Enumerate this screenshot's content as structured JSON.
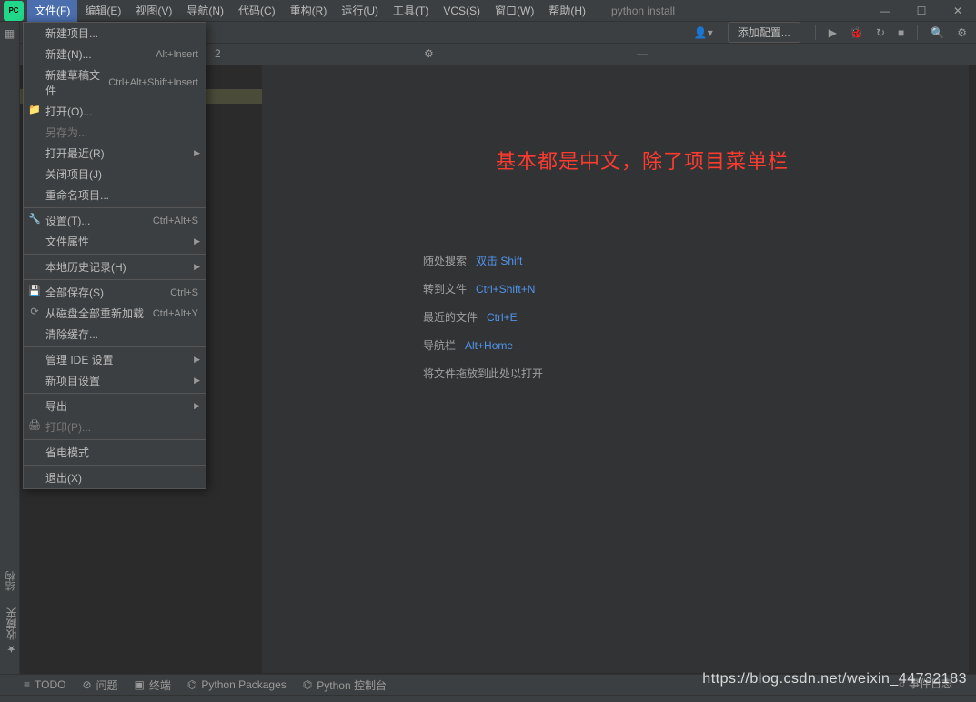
{
  "menubar": {
    "items": [
      {
        "label": "文件(F)",
        "active": true
      },
      {
        "label": "编辑(E)"
      },
      {
        "label": "视图(V)"
      },
      {
        "label": "导航(N)"
      },
      {
        "label": "代码(C)"
      },
      {
        "label": "重构(R)"
      },
      {
        "label": "运行(U)"
      },
      {
        "label": "工具(T)"
      },
      {
        "label": "VCS(S)"
      },
      {
        "label": "窗口(W)"
      },
      {
        "label": "帮助(H)"
      }
    ],
    "title": "python install"
  },
  "toolbar": {
    "config_label": "添加配置...",
    "user_icon": "user-icon"
  },
  "dropdown": [
    {
      "label": "新建项目..."
    },
    {
      "label": "新建(N)...",
      "shortcut": "Alt+Insert"
    },
    {
      "label": "新建草稿文件",
      "shortcut": "Ctrl+Alt+Shift+Insert"
    },
    {
      "label": "打开(O)...",
      "icon": "folder-icon"
    },
    {
      "label": "另存为...",
      "disabled": true
    },
    {
      "label": "打开最近(R)",
      "submenu": true
    },
    {
      "label": "关闭项目(J)"
    },
    {
      "label": "重命名项目..."
    },
    {
      "sep": true
    },
    {
      "label": "设置(T)...",
      "shortcut": "Ctrl+Alt+S",
      "icon": "wrench-icon"
    },
    {
      "label": "文件属性",
      "submenu": true
    },
    {
      "sep": true
    },
    {
      "label": "本地历史记录(H)",
      "submenu": true
    },
    {
      "sep": true
    },
    {
      "label": "全部保存(S)",
      "shortcut": "Ctrl+S",
      "icon": "save-icon"
    },
    {
      "label": "从磁盘全部重新加载",
      "shortcut": "Ctrl+Alt+Y",
      "icon": "reload-icon"
    },
    {
      "label": "清除缓存..."
    },
    {
      "sep": true
    },
    {
      "label": "管理 IDE 设置",
      "submenu": true
    },
    {
      "label": "新项目设置",
      "submenu": true
    },
    {
      "sep": true
    },
    {
      "label": "导出",
      "submenu": true
    },
    {
      "label": "打印(P)...",
      "disabled": true,
      "icon": "print-icon"
    },
    {
      "sep": true
    },
    {
      "label": "省电模式"
    },
    {
      "sep": true
    },
    {
      "label": "退出(X)"
    }
  ],
  "annotation": "基本都是中文，除了项目菜单栏",
  "welcome": {
    "rows": [
      {
        "label": "随处搜索",
        "link": "双击 Shift"
      },
      {
        "label": "转到文件",
        "link": "Ctrl+Shift+N"
      },
      {
        "label": "最近的文件",
        "link": "Ctrl+E"
      },
      {
        "label": "导航栏",
        "link": "Alt+Home"
      }
    ],
    "drop_hint": "将文件拖放到此处以打开"
  },
  "left_vertical": {
    "structure": "结构",
    "favorites": "收藏夹"
  },
  "bottombar": {
    "todo": "TODO",
    "problems": "问题",
    "terminal": "终端",
    "pypkg": "Python Packages",
    "pyconsole": "Python 控制台"
  },
  "status_corner": "事件日志",
  "watermark": "https://blog.csdn.net/weixin_44732183",
  "sidebar_visible_text": "2"
}
